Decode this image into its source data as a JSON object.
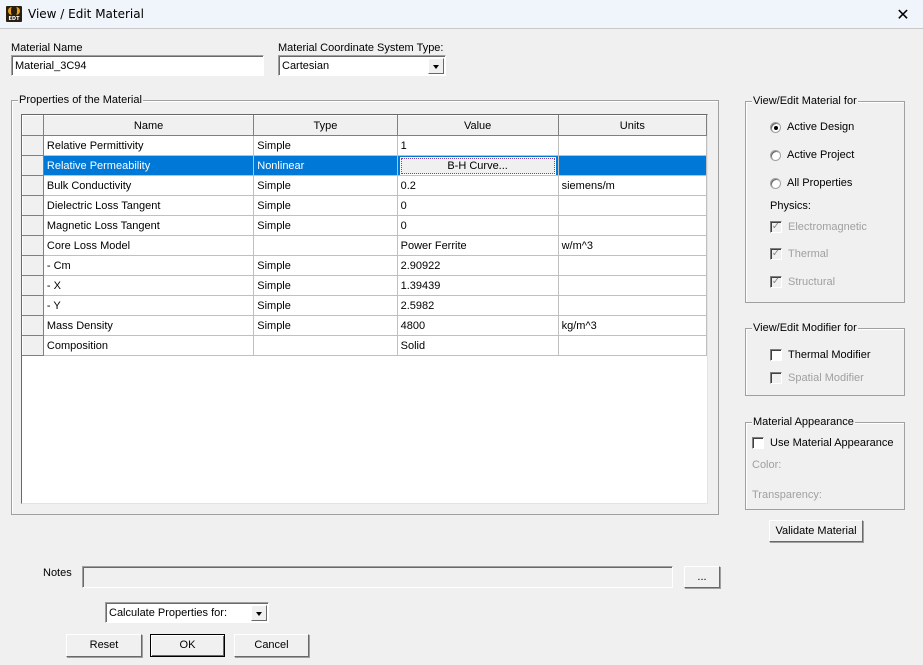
{
  "window": {
    "title": "View / Edit Material",
    "app_icon_text": "EDT",
    "close_symbol": "✕"
  },
  "material_name": {
    "label": "Material Name",
    "value": "Material_3C94"
  },
  "coord_system": {
    "label": "Material Coordinate System Type:",
    "selected": "Cartesian"
  },
  "properties": {
    "group_title": "Properties of the Material",
    "columns": [
      "Name",
      "Type",
      "Value",
      "Units"
    ],
    "rows": [
      {
        "name": "Relative Permittivity",
        "type": "Simple",
        "value": "1",
        "units": ""
      },
      {
        "name": "Relative Permeability",
        "type": "Nonlinear",
        "value": "B-H Curve...",
        "units": "",
        "selected": true,
        "value_is_button": true
      },
      {
        "name": "Bulk Conductivity",
        "type": "Simple",
        "value": "0.2",
        "units": "siemens/m"
      },
      {
        "name": "Dielectric Loss Tangent",
        "type": "Simple",
        "value": "0",
        "units": ""
      },
      {
        "name": "Magnetic Loss Tangent",
        "type": "Simple",
        "value": "0",
        "units": ""
      },
      {
        "name": "Core Loss Model",
        "type": "",
        "value": "Power Ferrite",
        "units": "w/m^3"
      },
      {
        "name": "-  Cm",
        "type": "Simple",
        "value": "2.90922",
        "units": ""
      },
      {
        "name": "- X",
        "type": "Simple",
        "value": "1.39439",
        "units": ""
      },
      {
        "name": "- Y",
        "type": "Simple",
        "value": "2.5982",
        "units": ""
      },
      {
        "name": "Mass Density",
        "type": "Simple",
        "value": "4800",
        "units": "kg/m^3"
      },
      {
        "name": "Composition",
        "type": "",
        "value": "Solid",
        "units": ""
      }
    ]
  },
  "view_edit_for": {
    "group_title": "View/Edit Material for",
    "options": [
      {
        "label": "Active Design",
        "checked": true
      },
      {
        "label": "Active Project",
        "checked": false
      },
      {
        "label": "All Properties",
        "checked": false
      }
    ],
    "physics_label": "Physics:",
    "physics": [
      {
        "label": "Electromagnetic",
        "checked": true,
        "enabled": false
      },
      {
        "label": "Thermal",
        "checked": true,
        "enabled": false
      },
      {
        "label": "Structural",
        "checked": true,
        "enabled": false
      }
    ]
  },
  "modifier": {
    "group_title": "View/Edit Modifier for",
    "thermal": {
      "label": "Thermal Modifier",
      "checked": false,
      "enabled": true
    },
    "spatial": {
      "label": "Spatial Modifier",
      "checked": false,
      "enabled": false
    }
  },
  "appearance": {
    "group_title": "Material Appearance",
    "use_label": "Use Material Appearance",
    "use_checked": false,
    "color_label": "Color:",
    "transparency_label": "Transparency:"
  },
  "validate_button": "Validate Material",
  "notes": {
    "label": "Notes",
    "value": "",
    "browse_button": "..."
  },
  "calculate": {
    "selected": "Calculate Properties for:"
  },
  "buttons": {
    "reset": "Reset",
    "ok": "OK",
    "cancel": "Cancel"
  },
  "colors": {
    "selection": "#0078d7",
    "background": "#f0f0f0"
  }
}
